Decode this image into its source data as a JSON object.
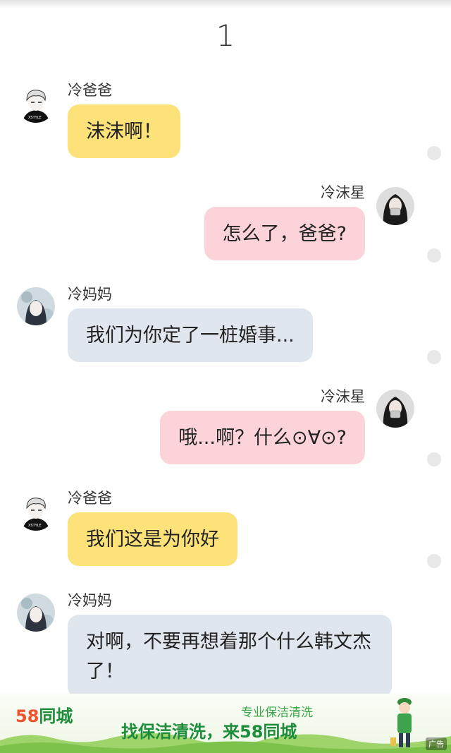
{
  "header": {
    "page_number": "1"
  },
  "messages": [
    {
      "side": "left",
      "name": "冷爸爸",
      "text": "沫沫啊！",
      "color": "yellow",
      "avatar": "dad-avatar"
    },
    {
      "side": "right",
      "name": "冷沫星",
      "text": "怎么了，爸爸?",
      "color": "pink",
      "avatar": "girl-avatar"
    },
    {
      "side": "left",
      "name": "冷妈妈",
      "text": "我们为你定了一桩婚事...",
      "color": "blue",
      "avatar": "mom-avatar"
    },
    {
      "side": "right",
      "name": "冷沫星",
      "text": "哦...啊？什么⊙∀⊙?",
      "color": "pink",
      "avatar": "girl-avatar"
    },
    {
      "side": "left",
      "name": "冷爸爸",
      "text": "我们这是为你好",
      "color": "yellow",
      "avatar": "dad-avatar"
    },
    {
      "side": "left",
      "name": "冷妈妈",
      "text": "对啊，不要再想着那个什么韩文杰了！",
      "color": "blue",
      "avatar": "mom-avatar"
    }
  ],
  "ad": {
    "logo_number": "58",
    "logo_text": "同城",
    "subtitle": "专业保洁清洗",
    "headline": "找保洁清洗，来58同城",
    "tag": "广告"
  },
  "colors": {
    "yellow": "#fde27a",
    "pink": "#fbd3d9",
    "blue": "#dfe6ee",
    "brand_green": "#1e8d3b",
    "brand_orange": "#f0532d"
  }
}
